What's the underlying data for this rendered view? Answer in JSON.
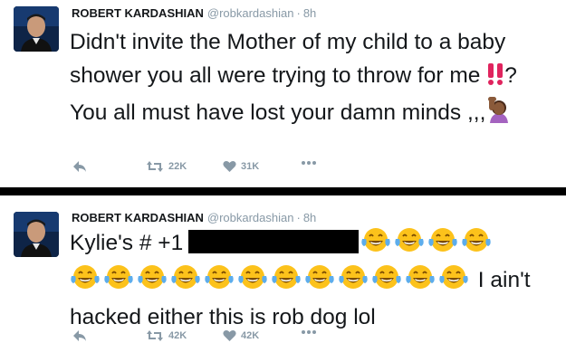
{
  "tweets": [
    {
      "name": "ROBERT KARDASHIAN",
      "handle": "@robkardashian",
      "separator": "·",
      "time": "8h",
      "text_parts": [
        "Didn't invite the Mother of my child to a baby shower you all were trying to throw for me ",
        "!!",
        "? You all must have lost your damn minds ,,,"
      ],
      "emoji": [
        "double-exclamation-icon",
        "facepalm-icon"
      ],
      "retweets": "22K",
      "likes": "31K"
    },
    {
      "name": "ROBERT KARDASHIAN",
      "handle": "@robkardashian",
      "separator": "·",
      "time": "8h",
      "text_before": "Kylie's # +1",
      "text_after": " I ain't hacked either this is rob dog lol",
      "emoji_after_redaction": 4,
      "emoji_line2": 12,
      "emoji": [
        "tears-of-joy-icon"
      ],
      "retweets": "42K",
      "likes": "42K"
    }
  ],
  "colors": {
    "meta": "#8899a6",
    "text": "#14171a",
    "accent_red": "#e0245e",
    "emoji_yellow": "#fcc21b"
  }
}
